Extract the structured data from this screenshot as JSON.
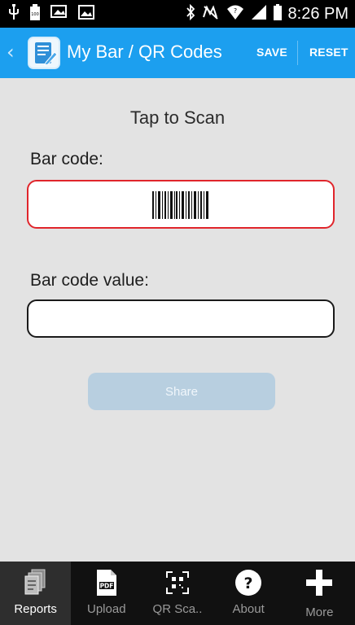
{
  "status_bar": {
    "time": "8:26 PM"
  },
  "action_bar": {
    "back_icon": "chevron-left-icon",
    "app_icon": "note-edit-icon",
    "title": "My Bar / QR Codes",
    "save_label": "SAVE",
    "reset_label": "RESET",
    "background_color": "#1c9fef"
  },
  "main": {
    "tap_to_scan": "Tap to Scan",
    "barcode_label": "Bar code:",
    "barcode_field_border_color": "#e0252b",
    "barcode_value_label": "Bar code value:",
    "barcode_value": "",
    "share_label": "Share"
  },
  "bottom_nav": {
    "items": [
      {
        "label": "Reports",
        "icon": "reports-icon",
        "active": true
      },
      {
        "label": "Upload",
        "icon": "pdf-upload-icon",
        "active": false
      },
      {
        "label": "QR Sca..",
        "icon": "qr-scan-icon",
        "active": false
      },
      {
        "label": "About",
        "icon": "help-icon",
        "active": false
      },
      {
        "label": "More",
        "icon": "plus-icon",
        "active": false
      }
    ]
  }
}
